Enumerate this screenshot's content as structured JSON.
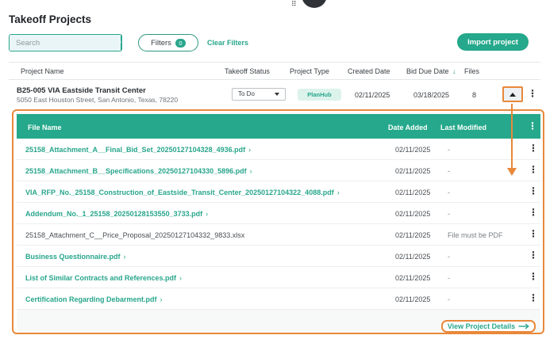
{
  "header": {
    "title": "Takeoff Projects"
  },
  "toolbar": {
    "search_placeholder": "Search",
    "filters_label": "Filters",
    "filters_count": "0",
    "clear_filters_label": "Clear Filters",
    "import_label": "Import project"
  },
  "table": {
    "columns": [
      "Project Name",
      "Takeoff Status",
      "Project Type",
      "Created Date",
      "Bid Due Date",
      "Files"
    ],
    "sort_indicator": "↓"
  },
  "project": {
    "name": "B25-005 VIA Eastside Transit Center",
    "address": "5050 East Houston Street, San Antonio, Texas, 78220",
    "status": "To Do",
    "type": "PlanHub",
    "created": "02/11/2025",
    "due": "03/18/2025",
    "files": "8"
  },
  "files": {
    "columns": [
      "File Name",
      "Date Added",
      "Last Modified"
    ],
    "rows": [
      {
        "name": "25158_Attachment_A__Final_Bid_Set_20250127104328_4936.pdf",
        "date": "02/11/2025",
        "modified": "-",
        "link": true
      },
      {
        "name": "25158_Attachment_B__Specifications_20250127104330_5896.pdf",
        "date": "02/11/2025",
        "modified": "-",
        "link": true
      },
      {
        "name": "VIA_RFP_No._25158_Construction_of_Eastside_Transit_Center_20250127104322_4088.pdf",
        "date": "02/11/2025",
        "modified": "-",
        "link": true
      },
      {
        "name": "Addendum_No._1_25158_20250128153550_3733.pdf",
        "date": "02/11/2025",
        "modified": "-",
        "link": true
      },
      {
        "name": "25158_Attachment_C__Price_Proposal_20250127104332_9833.xlsx",
        "date": "02/11/2025",
        "modified": "File must be PDF",
        "link": false
      },
      {
        "name": "Business Questionnaire.pdf",
        "date": "02/11/2025",
        "modified": "-",
        "link": true
      },
      {
        "name": "List of Similar Contracts and References.pdf",
        "date": "02/11/2025",
        "modified": "-",
        "link": true
      },
      {
        "name": "Certification Regarding Debarment.pdf",
        "date": "02/11/2025",
        "modified": "-",
        "link": true
      }
    ],
    "chevron": "›"
  },
  "footer": {
    "view_details_label": "View Project Details"
  },
  "colors": {
    "accent": "#25a88b",
    "highlight": "#e8883a",
    "pill_bg": "#dcf3ec"
  }
}
